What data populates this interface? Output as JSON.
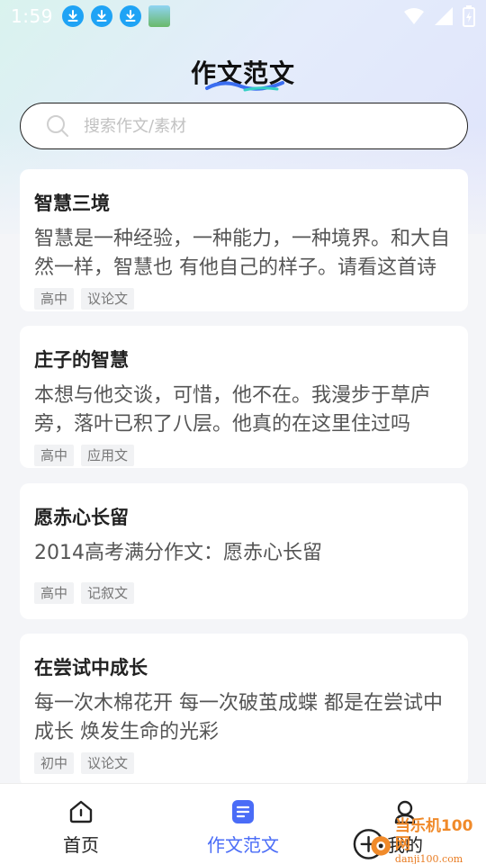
{
  "status_bar": {
    "time": "1:59",
    "icons": [
      "download-icon",
      "download-icon",
      "download-icon",
      "photo-thumbnail-icon",
      "wifi-icon",
      "signal-icon",
      "battery-charging-icon"
    ]
  },
  "header": {
    "title": "作文范文"
  },
  "search": {
    "placeholder": "搜索作文/素材"
  },
  "articles": [
    {
      "title": "智慧三境",
      "excerpt": "智慧是一种经验，一种能力，一种境界。和大自然一样，智慧也 有他自己的样子。请看这首诗",
      "tags": [
        "高中",
        "议论文"
      ]
    },
    {
      "title": "庄子的智慧",
      "excerpt": "本想与他交谈，可惜，他不在。我漫步于草庐旁，落叶已积了八层。他真的在这里住过吗",
      "tags": [
        "高中",
        "应用文"
      ]
    },
    {
      "title": "愿赤心长留",
      "excerpt": "2014高考满分作文：愿赤心长留",
      "tags": [
        "高中",
        "记叙文"
      ]
    },
    {
      "title": "在尝试中成长",
      "excerpt": "每一次木棉花开 每一次破茧成蝶 都是在尝试中成长 焕发生命的光彩",
      "tags": [
        "初中",
        "议论文"
      ]
    }
  ],
  "bottom_nav": {
    "items": [
      {
        "label": "首页",
        "icon": "home-icon",
        "active": false
      },
      {
        "label": "作文范文",
        "icon": "document-icon",
        "active": true
      },
      {
        "label": "我的",
        "icon": "user-icon",
        "active": false
      }
    ]
  },
  "watermark": {
    "text": "当乐机100网",
    "url_text": "danji100.com"
  },
  "colors": {
    "accent": "#4a6cf7",
    "status_download": "#1fa3f5"
  }
}
